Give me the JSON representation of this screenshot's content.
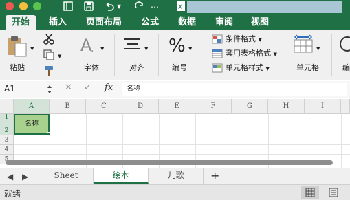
{
  "window": {
    "toolbar_icons": [
      "sidebar-icon",
      "save-icon",
      "undo-icon",
      "redo-icon",
      "excel-document-icon"
    ],
    "document_title": ""
  },
  "ribbon_tabs": [
    {
      "label": "开始",
      "active": true
    },
    {
      "label": "插入",
      "active": false
    },
    {
      "label": "页面布局",
      "active": false
    },
    {
      "label": "公式",
      "active": false
    },
    {
      "label": "数据",
      "active": false
    },
    {
      "label": "审阅",
      "active": false
    },
    {
      "label": "视图",
      "active": false
    }
  ],
  "ribbon": {
    "paste_label": "粘贴",
    "font_label": "字体",
    "align_label": "对齐",
    "number_label": "编号",
    "conditional_format_label": "条件格式",
    "table_format_label": "套用表格格式",
    "cell_style_label": "单元格样式",
    "cells_label": "单元格",
    "edit_label_partial": "编"
  },
  "formula_bar": {
    "name_box": "A1",
    "fx_label": "fx",
    "content": "名称"
  },
  "sheet": {
    "columns": [
      "A",
      "B",
      "C",
      "D",
      "E",
      "F",
      "G",
      "H",
      "I"
    ],
    "rows": [
      "1",
      "2",
      "3",
      "4",
      "5"
    ],
    "selected_cell_value": "名称"
  },
  "sheet_tabs": [
    {
      "label": "Sheet",
      "active": false
    },
    {
      "label": "绘本",
      "active": true
    },
    {
      "label": "儿歌",
      "active": false
    }
  ],
  "add_sheet_label": "+",
  "status": {
    "text": "就绪"
  },
  "colors": {
    "brand_green": "#1f7145",
    "selection_fill": "#a9d18e"
  }
}
